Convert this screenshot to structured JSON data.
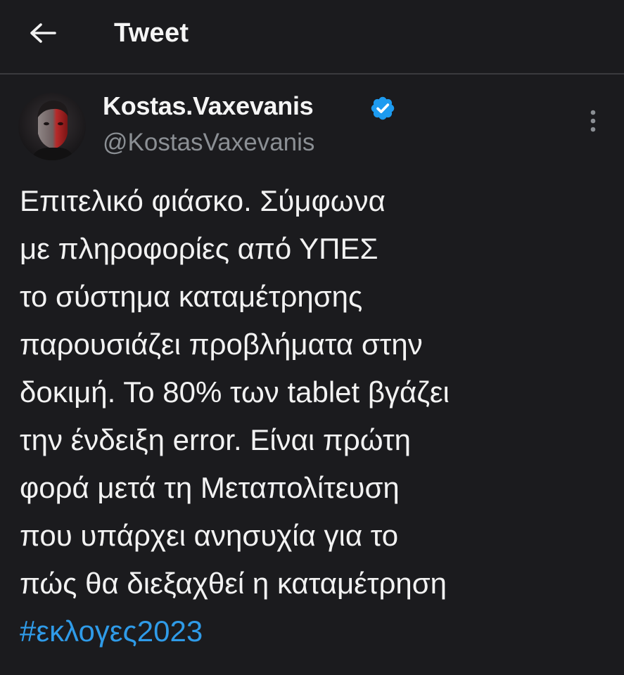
{
  "header": {
    "title": "Tweet",
    "back_icon": "arrow-left-icon"
  },
  "tweet": {
    "author": {
      "display_name": "Kostas.Vaxevanis",
      "handle": "@KostasVaxevanis",
      "verified_icon": "verified-badge-icon",
      "verified_color": "#1d9bf0"
    },
    "more_icon": "more-vertical-icon",
    "text_lines": [
      "Επιτελικό φιάσκο. Σύμφωνα",
      "με πληροφορίες από ΥΠΕΣ",
      "το σύστημα καταμέτρησης",
      "παρουσιάζει προβλήματα στην",
      "δοκιμή. Το 80% των tablet βγάζει",
      "την ένδειξη error. Είναι πρώτη",
      "φορά μετά τη Μεταπολίτευση",
      "που υπάρχει ανησυχία για το",
      "πώς θα διεξαχθεί η καταμέτρηση"
    ],
    "hashtag": "#εκλογες2023",
    "hashtag_color": "#2f9be8"
  },
  "colors": {
    "background": "#1b1b1e",
    "text": "#f2f2f2",
    "secondary_text": "#8b8f94",
    "divider": "#3a3a3e"
  }
}
